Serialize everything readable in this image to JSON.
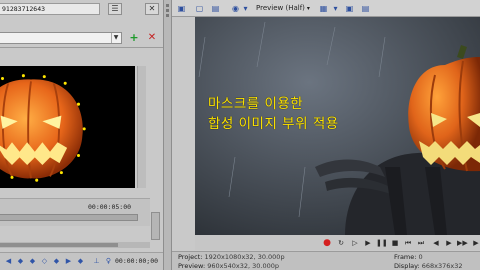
{
  "left_panel": {
    "path_text": "91283712643",
    "dropdown_value": "",
    "timecode_start": "",
    "timecode_mid": "00:00:05:00",
    "timecode_end": "00:00:00;00",
    "icons": [
      "add-icon",
      "delete-icon"
    ]
  },
  "preview_toolbar": {
    "mode_label": "Preview (Half)"
  },
  "overlay": {
    "line1": "마스크를 이용한",
    "line2": "합성 이미지 부위 적용"
  },
  "status": {
    "project_label": "Project:",
    "project_value": "1920x1080x32, 30.000p",
    "preview_label": "Preview:",
    "preview_value": "960x540x32, 30.000p",
    "frame_label": "Frame:",
    "frame_value": "0",
    "display_label": "Display:",
    "display_value": "668x376x32"
  },
  "colors": {
    "overlay_text": "#ffe500",
    "pumpkin": "#e0641a",
    "record": "#d41f1f"
  }
}
